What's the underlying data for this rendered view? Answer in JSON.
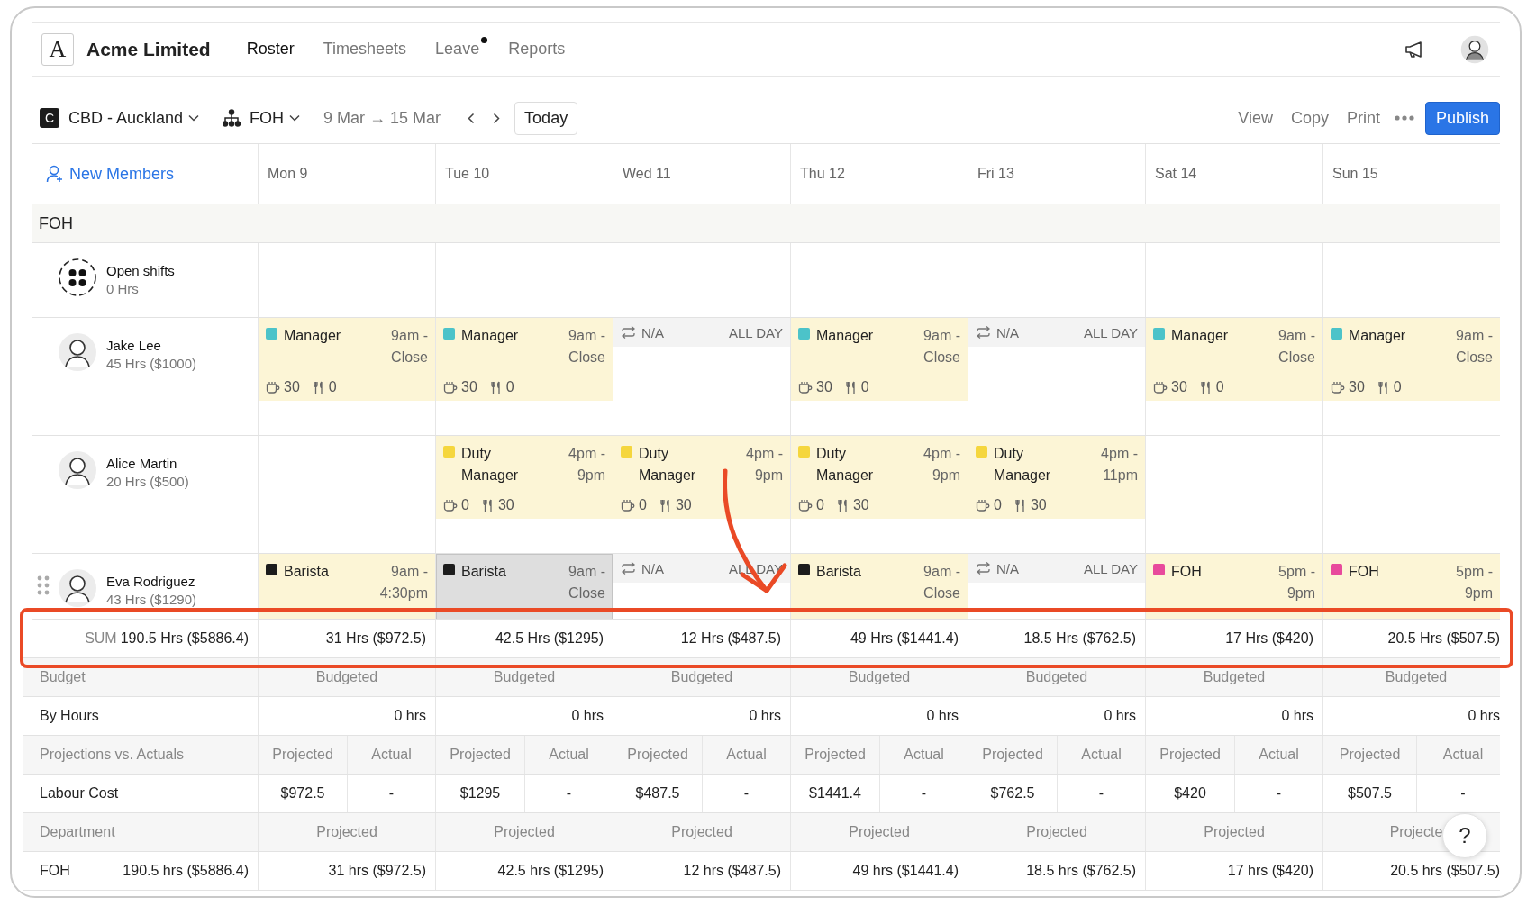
{
  "brand": {
    "logo_letter": "A",
    "name": "Acme Limited"
  },
  "nav": [
    {
      "label": "Roster",
      "selected": true,
      "notification": false
    },
    {
      "label": "Timesheets",
      "selected": false,
      "notification": false
    },
    {
      "label": "Leave",
      "selected": false,
      "notification": true
    },
    {
      "label": "Reports",
      "selected": false,
      "notification": false
    }
  ],
  "toolbar": {
    "location_badge": "C",
    "location": "CBD - Auckland",
    "department": "FOH",
    "date_range": "9 Mar → 15 Mar",
    "today": "Today",
    "actions": [
      "View",
      "Copy",
      "Print"
    ],
    "publish": "Publish"
  },
  "new_members": "New Members",
  "days": [
    "Mon 9",
    "Tue 10",
    "Wed 11",
    "Thu 12",
    "Fri 13",
    "Sat 14",
    "Sun 15"
  ],
  "group": "FOH",
  "members": [
    {
      "kind": "open",
      "name": "Open shifts",
      "hours": "0 Hrs",
      "draggable": false,
      "shifts": [
        {
          "kind": "empty"
        },
        {
          "kind": "empty"
        },
        {
          "kind": "empty"
        },
        {
          "kind": "empty"
        },
        {
          "kind": "empty"
        },
        {
          "kind": "empty"
        },
        {
          "kind": "empty"
        }
      ]
    },
    {
      "kind": "person",
      "name": "Jake Lee",
      "hours": "45 Hrs ($1000)",
      "draggable": false,
      "shifts": [
        {
          "kind": "shift",
          "role": "Manager",
          "color": "#4cc3c9",
          "time": "9am - Close",
          "selected": false,
          "breaks": [
            {
              "kind": "rest",
              "value": "30"
            },
            {
              "kind": "meal",
              "value": "0"
            }
          ]
        },
        {
          "kind": "shift",
          "role": "Manager",
          "color": "#4cc3c9",
          "time": "9am - Close",
          "selected": false,
          "breaks": [
            {
              "kind": "rest",
              "value": "30"
            },
            {
              "kind": "meal",
              "value": "0"
            }
          ]
        },
        {
          "kind": "unavailable",
          "label": "N/A",
          "time": "ALL DAY"
        },
        {
          "kind": "shift",
          "role": "Manager",
          "color": "#4cc3c9",
          "time": "9am - Close",
          "selected": false,
          "breaks": [
            {
              "kind": "rest",
              "value": "30"
            },
            {
              "kind": "meal",
              "value": "0"
            }
          ]
        },
        {
          "kind": "unavailable",
          "label": "N/A",
          "time": "ALL DAY"
        },
        {
          "kind": "shift",
          "role": "Manager",
          "color": "#4cc3c9",
          "time": "9am - Close",
          "selected": false,
          "breaks": [
            {
              "kind": "rest",
              "value": "30"
            },
            {
              "kind": "meal",
              "value": "0"
            }
          ]
        },
        {
          "kind": "shift",
          "role": "Manager",
          "color": "#4cc3c9",
          "time": "9am - Close",
          "selected": false,
          "breaks": [
            {
              "kind": "rest",
              "value": "30"
            },
            {
              "kind": "meal",
              "value": "0"
            }
          ]
        }
      ]
    },
    {
      "kind": "person",
      "name": "Alice Martin",
      "hours": "20 Hrs ($500)",
      "draggable": false,
      "shifts": [
        {
          "kind": "empty"
        },
        {
          "kind": "shift",
          "role": "Duty Manager",
          "color": "#f5d63d",
          "time": "4pm - 9pm",
          "selected": false,
          "breaks": [
            {
              "kind": "rest",
              "value": "0"
            },
            {
              "kind": "meal",
              "value": "30"
            }
          ]
        },
        {
          "kind": "shift",
          "role": "Duty Manager",
          "color": "#f5d63d",
          "time": "4pm - 9pm",
          "selected": false,
          "breaks": [
            {
              "kind": "rest",
              "value": "0"
            },
            {
              "kind": "meal",
              "value": "30"
            }
          ]
        },
        {
          "kind": "shift",
          "role": "Duty Manager",
          "color": "#f5d63d",
          "time": "4pm - 9pm",
          "selected": false,
          "breaks": [
            {
              "kind": "rest",
              "value": "0"
            },
            {
              "kind": "meal",
              "value": "30"
            }
          ]
        },
        {
          "kind": "shift",
          "role": "Duty Manager",
          "color": "#f5d63d",
          "time": "4pm - 11pm",
          "selected": false,
          "breaks": [
            {
              "kind": "rest",
              "value": "0"
            },
            {
              "kind": "meal",
              "value": "30"
            }
          ]
        },
        {
          "kind": "empty"
        },
        {
          "kind": "empty"
        }
      ]
    },
    {
      "kind": "person",
      "name": "Eva Rodriguez",
      "hours": "43 Hrs ($1290)",
      "draggable": true,
      "shifts": [
        {
          "kind": "shift",
          "role": "Barista",
          "color": "#1c1c1c",
          "time": "9am - 4:30pm",
          "selected": false
        },
        {
          "kind": "shift",
          "role": "Barista",
          "color": "#1c1c1c",
          "time": "9am - Close",
          "selected": true
        },
        {
          "kind": "unavailable",
          "label": "N/A",
          "time": "ALL DAY"
        },
        {
          "kind": "shift",
          "role": "Barista",
          "color": "#1c1c1c",
          "time": "9am - Close",
          "selected": false
        },
        {
          "kind": "unavailable",
          "label": "N/A",
          "time": "ALL DAY"
        },
        {
          "kind": "shift",
          "role": "FOH",
          "color": "#e84a9c",
          "time": "5pm - 9pm",
          "selected": false
        },
        {
          "kind": "shift",
          "role": "FOH",
          "color": "#e84a9c",
          "time": "5pm - 9pm",
          "selected": false
        }
      ]
    }
  ],
  "summary": [
    {
      "kind": "sum",
      "label": "SUM",
      "total": "190.5 Hrs ($5886.4)",
      "cells": [
        "31 Hrs ($972.5)",
        "42.5 Hrs ($1295)",
        "12 Hrs ($487.5)",
        "49 Hrs ($1441.4)",
        "18.5 Hrs ($762.5)",
        "17 Hrs ($420)",
        "20.5 Hrs ($507.5)"
      ]
    },
    {
      "kind": "header",
      "label": "Budget",
      "cells": [
        "Budgeted",
        "Budgeted",
        "Budgeted",
        "Budgeted",
        "Budgeted",
        "Budgeted",
        "Budgeted"
      ]
    },
    {
      "kind": "values",
      "label": "By Hours",
      "cells": [
        "0 hrs",
        "0 hrs",
        "0 hrs",
        "0 hrs",
        "0 hrs",
        "0 hrs",
        "0 hrs"
      ]
    },
    {
      "kind": "split_header",
      "label": "Projections vs. Actuals",
      "cells": [
        [
          "Projected",
          "Actual"
        ],
        [
          "Projected",
          "Actual"
        ],
        [
          "Projected",
          "Actual"
        ],
        [
          "Projected",
          "Actual"
        ],
        [
          "Projected",
          "Actual"
        ],
        [
          "Projected",
          "Actual"
        ],
        [
          "Projected",
          "Actual"
        ]
      ]
    },
    {
      "kind": "split_values",
      "label": "Labour Cost",
      "cells": [
        [
          "$972.5",
          "-"
        ],
        [
          "$1295",
          "-"
        ],
        [
          "$487.5",
          "-"
        ],
        [
          "$1441.4",
          "-"
        ],
        [
          "$762.5",
          "-"
        ],
        [
          "$420",
          "-"
        ],
        [
          "$507.5",
          "-"
        ]
      ]
    },
    {
      "kind": "header",
      "label": "Department",
      "cells": [
        "Projected",
        "Projected",
        "Projected",
        "Projected",
        "Projected",
        "Projected",
        "Projecte"
      ]
    },
    {
      "kind": "values",
      "label": "FOH",
      "total": "190.5 hrs ($5886.4)",
      "cells": [
        "31 hrs ($972.5)",
        "42.5 hrs ($1295)",
        "12 hrs ($487.5)",
        "49 hrs ($1441.4)",
        "18.5 hrs ($762.5)",
        "17 hrs ($420)",
        "20.5 hrs ($507.5)"
      ]
    }
  ],
  "help": "?"
}
